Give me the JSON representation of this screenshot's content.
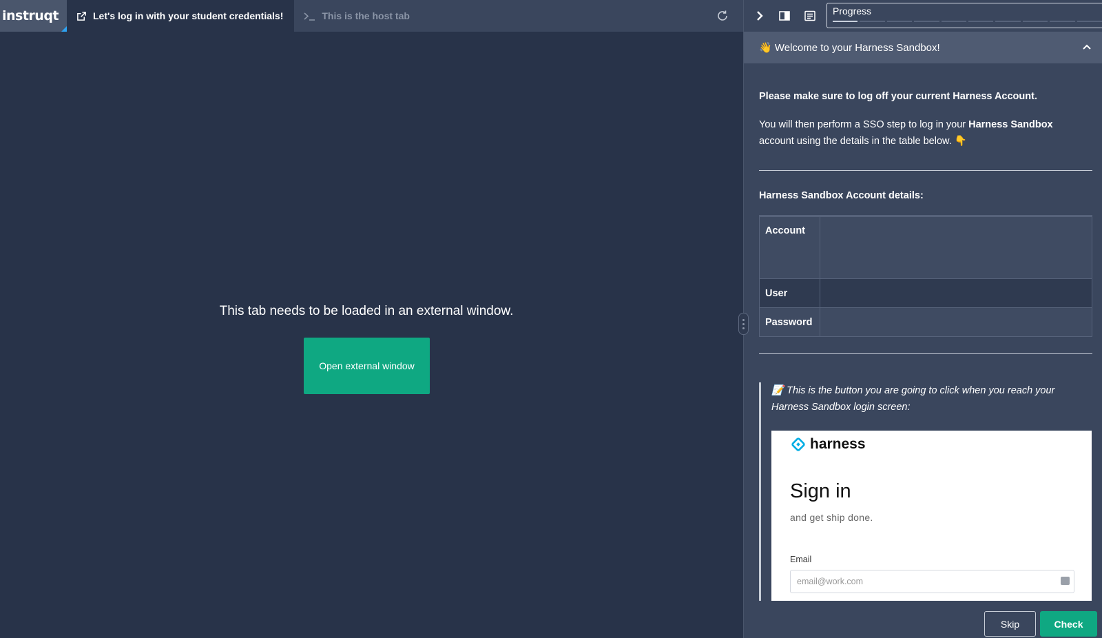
{
  "app": {
    "logo_text": "instruqt"
  },
  "tabs": [
    {
      "label": "Let's log in with your student credentials!",
      "icon": "external-link-icon",
      "active": true
    },
    {
      "label": "This is the host tab",
      "icon": "terminal-icon",
      "active": false
    }
  ],
  "main": {
    "message": "This tab needs to be loaded in an external window.",
    "open_button_label": "Open external window"
  },
  "sidebar": {
    "progress_label": "Progress",
    "progress_completed_steps": 1,
    "progress_total_steps": 10,
    "section_title": "👋 Welcome to your Harness Sandbox!",
    "intro_bold": "Please make sure to log off your current Harness Account.",
    "intro_line_a": "You will then perform a SSO step to log in your ",
    "intro_line_b": "Harness Sandbox",
    "intro_line_c": " account using the details in the table below. 👇",
    "details_heading": "Harness Sandbox Account details:",
    "table": [
      {
        "key": "Account",
        "value": ""
      },
      {
        "key": "User",
        "value": ""
      },
      {
        "key": "Password",
        "value": ""
      }
    ],
    "quote_text": "📝 This is the button you are going to click when you reach your Harness Sandbox login screen:",
    "login_screenshot": {
      "brand": "harness",
      "title": "Sign in",
      "subtitle": "and get ship done.",
      "email_label": "Email",
      "email_placeholder": "email@work.com"
    }
  },
  "footer": {
    "skip_label": "Skip",
    "check_label": "Check"
  },
  "colors": {
    "background": "#283349",
    "panel": "#3a465d",
    "accent": "#0fa882",
    "harness_blue": "#00ade4"
  }
}
